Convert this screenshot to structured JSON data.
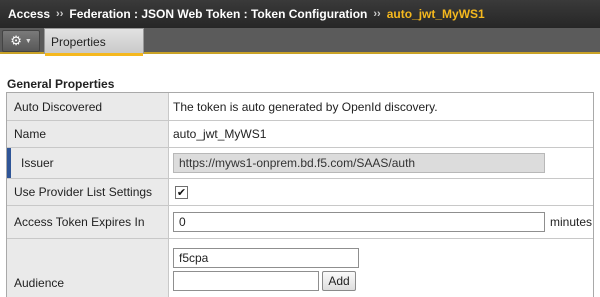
{
  "breadcrumb": {
    "items": [
      "Access",
      "Federation : JSON Web Token : Token Configuration"
    ],
    "current": "auto_jwt_MyWS1",
    "separator": "››"
  },
  "tabs": {
    "gear_icon": "gear-icon",
    "properties_label": "Properties"
  },
  "section": {
    "title": "General Properties"
  },
  "rows": {
    "auto_discovered": {
      "label": "Auto Discovered",
      "value": "The token is auto generated by OpenId discovery."
    },
    "name": {
      "label": "Name",
      "value": "auto_jwt_MyWS1"
    },
    "issuer": {
      "label": "Issuer",
      "value": "https://myws1-onprem.bd.f5.com/SAAS/auth"
    },
    "use_provider": {
      "label": "Use Provider List Settings",
      "checked": true,
      "check_glyph": "✔"
    },
    "expires": {
      "label": "Access Token Expires In",
      "value": "0",
      "unit": "minutes"
    },
    "audience": {
      "label": "Audience",
      "items": [
        "f5cpa"
      ],
      "new_value": "",
      "add_label": "Add"
    }
  },
  "colors": {
    "header_bg": "#262626",
    "accent": "#f5b81e",
    "required_marker": "#2f5597",
    "label_bg": "#eaeaea"
  }
}
